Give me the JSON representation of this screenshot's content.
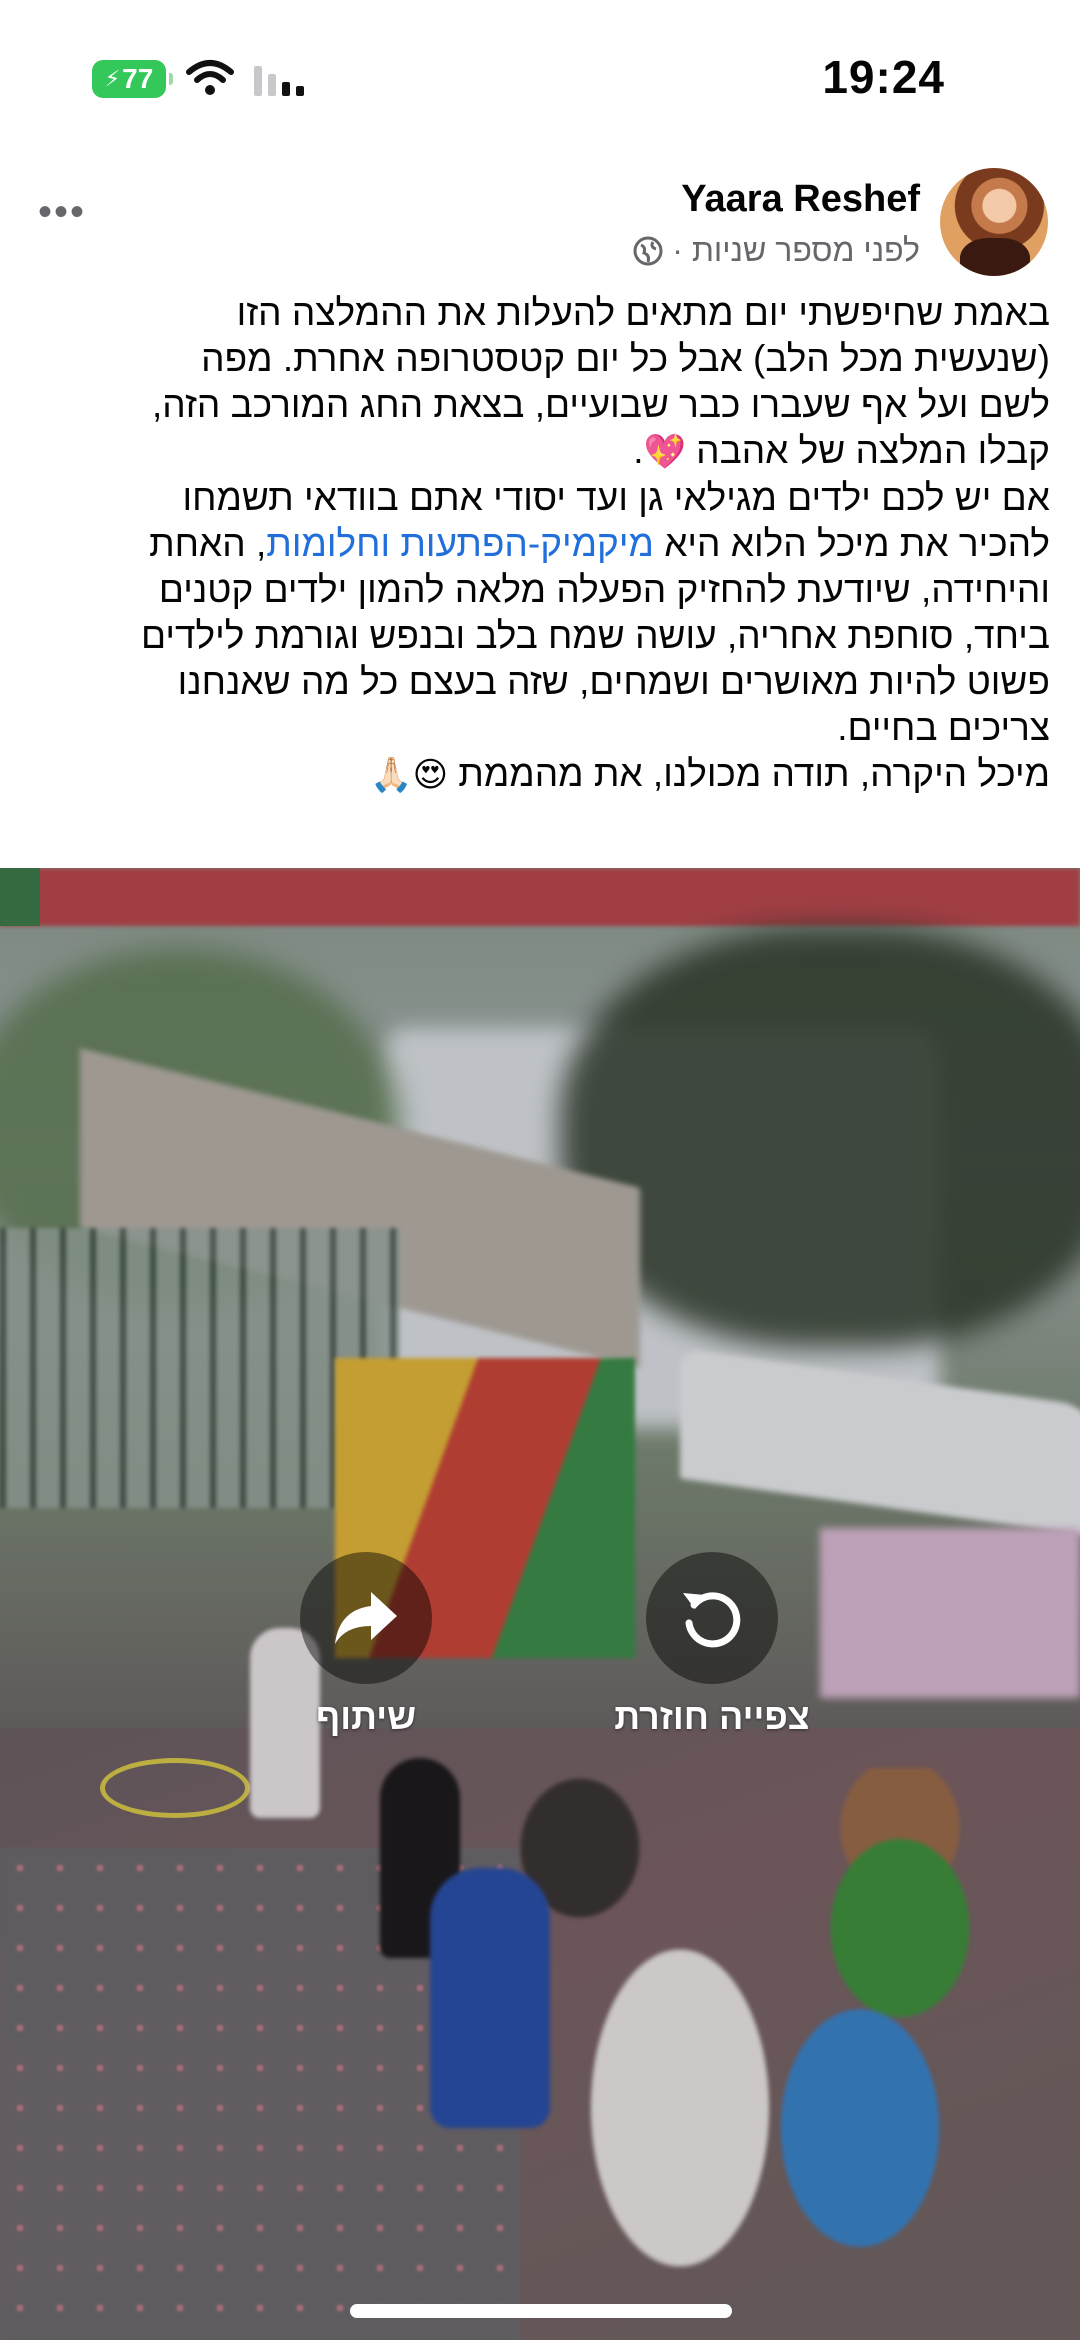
{
  "status_bar": {
    "time": "19:24",
    "battery": "77",
    "icons": [
      "battery-icon",
      "wifi-icon",
      "signal-icon"
    ]
  },
  "post": {
    "author": "Yaara Reshef",
    "meta": "לפני מספר שניות ·",
    "privacy_icon": "globe-icon",
    "more_icon": "more-icon",
    "paragraph1": [
      "באמת שחיפשתי יום מתאים להעלות את ההמלצה הזו",
      "(שנעשית מכל הלב) אבל כל יום קטסטרופה אחרת. מפה",
      "לשם ועל אף שעברו כבר שבועיים, בצאת החג המורכב הזה,",
      "קבלו המלצה של אהבה"
    ],
    "heart_emoji": "💖",
    "paragraph2": {
      "line1": "אם יש לכם ילדים מגילאי גן ועד יסודי אתם בוודאי תשמחו",
      "line2_before": "להכיר את מיכל הלוא היא ",
      "line2_link": "מיקמיק-הפתעות וחלומות",
      "line2_after": ", האחת",
      "rest": [
        "והיחידה, שיודעת להחזיק הפעלה מלאה להמון ילדים קטנים",
        "ביחד, סוחפת אחריה, עושה שמח בלב ובנפש וגורמת לילדים",
        "פשוט להיות מאושרים ושמחים, שזה בעצם כל מה שאנחנו",
        "צריכים בחיים."
      ]
    },
    "paragraph3": "מיכל היקרה, תודה מכולנו, את מהממת",
    "closing_emojis": "😍🙏🏻"
  },
  "video": {
    "share_label": "שיתוף",
    "replay_label": "צפייה חוזרת",
    "share_icon": "share-arrow-icon",
    "replay_icon": "replay-icon"
  },
  "colors": {
    "link": "#216fdb",
    "meta": "#65676b",
    "battery": "#34c759"
  }
}
